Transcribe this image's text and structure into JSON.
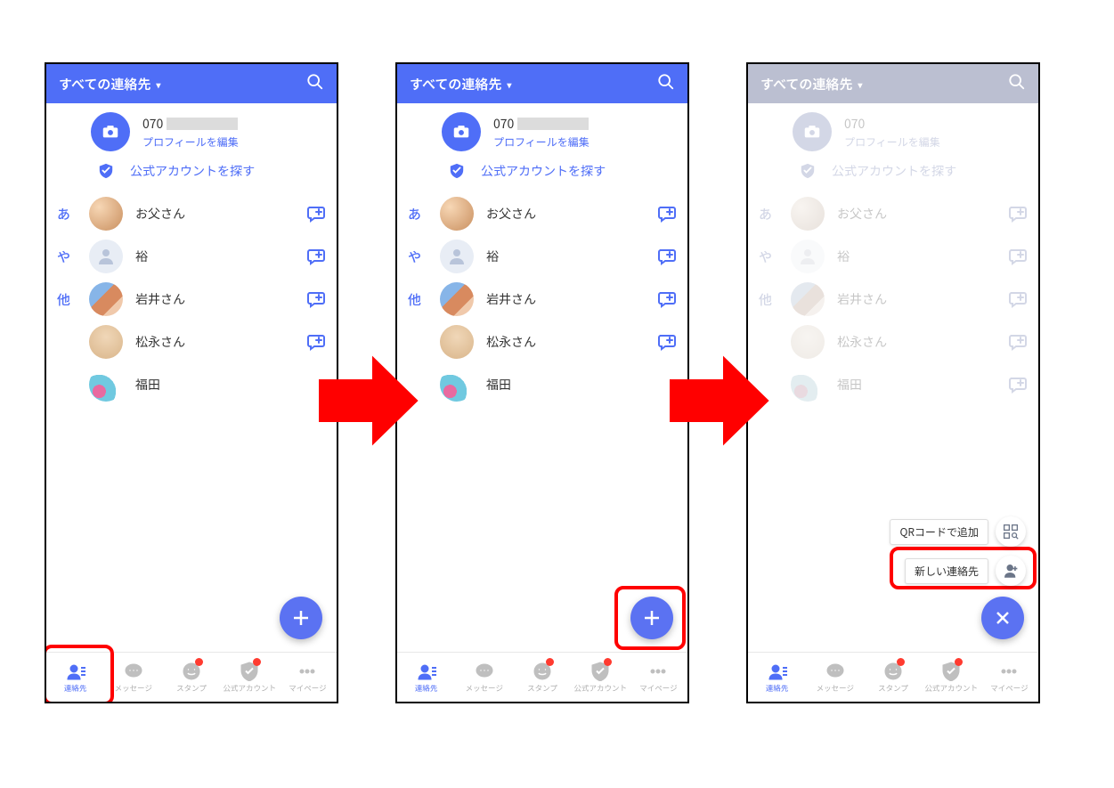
{
  "header": {
    "title": "すべての連絡先",
    "dropdown_icon": "chevron-down-icon",
    "search_icon": "search-icon"
  },
  "profile": {
    "camera_icon": "camera-icon",
    "phone_partial": "070",
    "edit_link": "プロフィールを編集"
  },
  "official": {
    "icon": "shield-check-icon",
    "label": "公式アカウントを探す"
  },
  "index_letters": [
    "あ",
    "や",
    "他"
  ],
  "contacts": [
    {
      "index": "あ",
      "name": "お父さん",
      "avatar": "av1"
    },
    {
      "index": "や",
      "name": "裕",
      "avatar": "av2"
    },
    {
      "index": "他",
      "name": "岩井さん",
      "avatar": "av3"
    },
    {
      "index": "",
      "name": "松永さん",
      "avatar": "av4"
    },
    {
      "index": "",
      "name": "福田",
      "avatar": "av5"
    }
  ],
  "contact_action_icon": "new-chat-icon",
  "fab": {
    "plus_icon": "plus-icon",
    "close_icon": "close-icon"
  },
  "fab_menu": {
    "qr_label": "QRコードで追加",
    "qr_icon": "qr-icon",
    "new_contact_label": "新しい連絡先",
    "new_contact_icon": "add-person-icon"
  },
  "nav": {
    "items": [
      {
        "id": "contacts",
        "label": "連絡先",
        "icon": "contacts-icon",
        "badge": false,
        "active": true
      },
      {
        "id": "messages",
        "label": "メッセージ",
        "icon": "messages-icon",
        "badge": false,
        "active": false
      },
      {
        "id": "stamps",
        "label": "スタンプ",
        "icon": "stamps-icon",
        "badge": true,
        "active": false
      },
      {
        "id": "official",
        "label": "公式アカウント",
        "icon": "official-icon",
        "badge": true,
        "active": false
      },
      {
        "id": "mypage",
        "label": "マイページ",
        "icon": "mypage-icon",
        "badge": false,
        "active": false
      }
    ]
  },
  "highlights": {
    "screen1": "nav_contacts_tab",
    "screen2": "fab_plus_button",
    "screen3": "new_contact_action"
  },
  "colors": {
    "primary": "#4f6ef7",
    "highlight": "#ff0000",
    "arrow": "#ff0000",
    "badge": "#ff3b30"
  }
}
